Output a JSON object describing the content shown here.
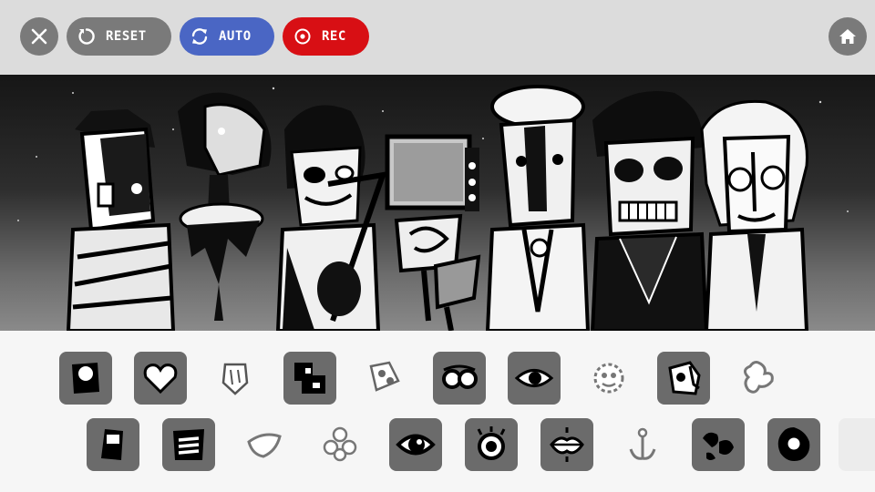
{
  "toolbar": {
    "close_icon": "close-icon",
    "reset_label": "RESET",
    "reset_icon": "reset-icon",
    "auto_label": "AUTO",
    "auto_icon": "sync-icon",
    "rec_label": "REC",
    "rec_icon": "record-icon",
    "home_icon": "home-icon"
  },
  "colors": {
    "toolbar_bg": "#dcdcdc",
    "button_gray": "#7a7a7a",
    "auto_blue": "#4a66c4",
    "rec_red": "#d80f14",
    "tile_active": "#6b6b6b",
    "palette_bg": "#f6f6f6"
  },
  "palette": {
    "row1": [
      {
        "icon": "mask-bulb-icon",
        "active": true
      },
      {
        "icon": "heart-icon",
        "active": true
      },
      {
        "icon": "shield-mask-icon",
        "active": false
      },
      {
        "icon": "blocks-icon",
        "active": true
      },
      {
        "icon": "tilted-eyes-icon",
        "active": false
      },
      {
        "icon": "glasses-icon",
        "active": true
      },
      {
        "icon": "eye-icon",
        "active": true
      },
      {
        "icon": "fuzzy-face-icon",
        "active": false
      },
      {
        "icon": "broken-face-icon",
        "active": true
      },
      {
        "icon": "splat-icon",
        "active": false
      }
    ],
    "row2": [
      {
        "icon": "phone-icon",
        "active": true
      },
      {
        "icon": "stripes-icon",
        "active": true
      },
      {
        "icon": "beak-icon",
        "active": false
      },
      {
        "icon": "flower-icon",
        "active": false
      },
      {
        "icon": "big-eye-icon",
        "active": true
      },
      {
        "icon": "lashed-eye-icon",
        "active": true
      },
      {
        "icon": "lips-icon",
        "active": true
      },
      {
        "icon": "anchor-icon",
        "active": false
      },
      {
        "icon": "hands-icon",
        "active": true
      },
      {
        "icon": "ring-blob-icon",
        "active": true
      }
    ]
  }
}
